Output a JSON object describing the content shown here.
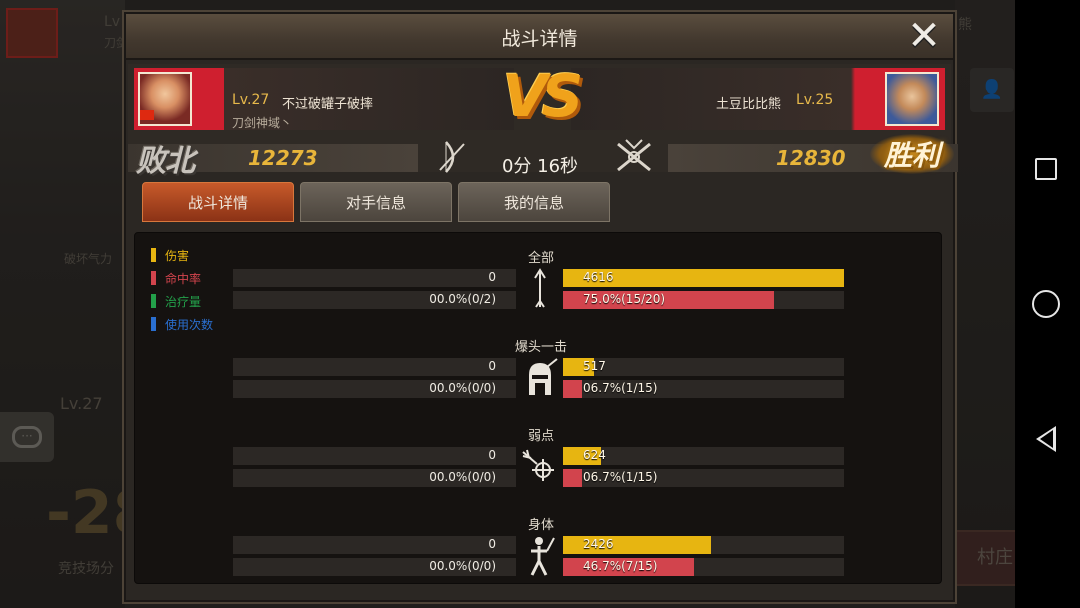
{
  "dialog": {
    "title": "战斗详情",
    "close_glyph": "✕"
  },
  "left_player": {
    "level": "Lv.27",
    "name": "不过破罐子破摔",
    "guild": "刀剑神域丶",
    "score": "12273",
    "result": "败北"
  },
  "right_player": {
    "level": "Lv.25",
    "name": "土豆比比熊",
    "score": "12830",
    "result": "胜利"
  },
  "vs_label": "VS",
  "battle_time": "0分 16秒",
  "tabs": [
    {
      "label": "战斗详情",
      "active": true
    },
    {
      "label": "对手信息",
      "active": false
    },
    {
      "label": "我的信息",
      "active": false
    }
  ],
  "legend": [
    {
      "label": "伤害",
      "color": "#e7b511"
    },
    {
      "label": "命中率",
      "color": "#d2444d"
    },
    {
      "label": "治疗量",
      "color": "#23a04a"
    },
    {
      "label": "使用次数",
      "color": "#2a6fd0"
    }
  ],
  "sections": [
    {
      "title": "全部",
      "icon": "arrow-up-icon",
      "left_damage": "0",
      "left_hit": "00.0%(0/2)",
      "right_damage": "4616",
      "right_damage_ratio": 1.0,
      "right_hit": "75.0%(15/20)",
      "right_hit_ratio": 0.75
    },
    {
      "title": "爆头一击",
      "icon": "helmet-icon",
      "left_damage": "0",
      "left_hit": "00.0%(0/0)",
      "right_damage": "517",
      "right_damage_ratio": 0.112,
      "right_hit": "06.7%(1/15)",
      "right_hit_ratio": 0.067
    },
    {
      "title": "弱点",
      "icon": "weakpoint-icon",
      "left_damage": "0",
      "left_hit": "00.0%(0/0)",
      "right_damage": "624",
      "right_damage_ratio": 0.135,
      "right_hit": "06.7%(1/15)",
      "right_hit_ratio": 0.067
    },
    {
      "title": "身体",
      "icon": "body-icon",
      "left_damage": "0",
      "left_hit": "00.0%(0/0)",
      "right_damage": "2426",
      "right_damage_ratio": 0.526,
      "right_hit": "46.7%(7/15)",
      "right_hit_ratio": 0.467
    }
  ],
  "background": {
    "left_text_1": "Lv",
    "left_text_2": "刀剑",
    "left_text_3": "破坏气力",
    "left_level": "Lv.27",
    "left_big_num": "-28",
    "left_bottom": "竞技场分",
    "right_text": "熊",
    "village_btn": "村庄"
  }
}
